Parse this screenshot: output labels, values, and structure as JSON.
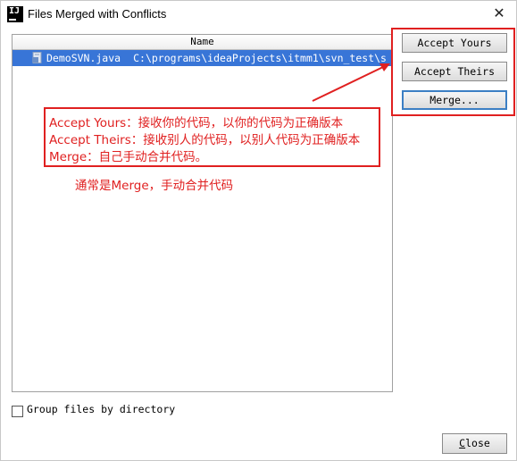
{
  "window": {
    "title": "Files Merged with Conflicts",
    "app_icon_text": "IJ",
    "close_glyph": "✕"
  },
  "table": {
    "column_header": "Name",
    "rows": [
      {
        "file": "DemoSVN.java",
        "path": "C:\\programs\\ideaProjects\\itmm1\\svn_test\\s",
        "selected": true
      }
    ]
  },
  "buttons": {
    "accept_yours": "Accept Yours",
    "accept_theirs": "Accept Theirs",
    "merge": "Merge...",
    "close_underlined": "C",
    "close_rest": "lose"
  },
  "options": {
    "group_files_label": "Group files by directory",
    "group_files_checked": false
  },
  "annotations": {
    "lines": [
      "Accept Yours：接收你的代码，以你的代码为正确版本",
      "Accept Theirs：接收别人的代码，以别人代码为正确版本",
      "Merge：自己手动合并代码。"
    ],
    "note": "通常是Merge，手动合并代码"
  },
  "colors": {
    "selection": "#3875d7",
    "annotation_red": "#e02020",
    "default_button_border": "#3c7fc4"
  },
  "icons": {
    "app": "intellij-idea-icon",
    "file": "java-file-icon",
    "close": "close-icon"
  }
}
